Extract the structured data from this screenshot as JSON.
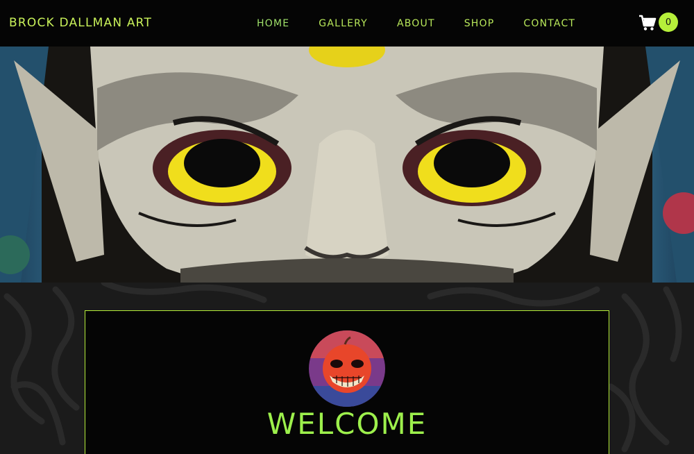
{
  "header": {
    "brand": "BROCK DALLMAN ART",
    "nav": [
      {
        "label": "HOME",
        "active": true
      },
      {
        "label": "GALLERY"
      },
      {
        "label": "ABOUT"
      },
      {
        "label": "SHOP"
      },
      {
        "label": "CONTACT"
      }
    ],
    "cart": {
      "icon": "cart-icon",
      "count": "0"
    }
  },
  "hero": {
    "image": "oni-mask-painting"
  },
  "welcome": {
    "avatar": "grinning-apple-creature",
    "title": "WELCOME",
    "text": ""
  },
  "colors": {
    "accent": "#b6ef3a",
    "header_bg": "#050505",
    "title_green": "#9df04c"
  }
}
